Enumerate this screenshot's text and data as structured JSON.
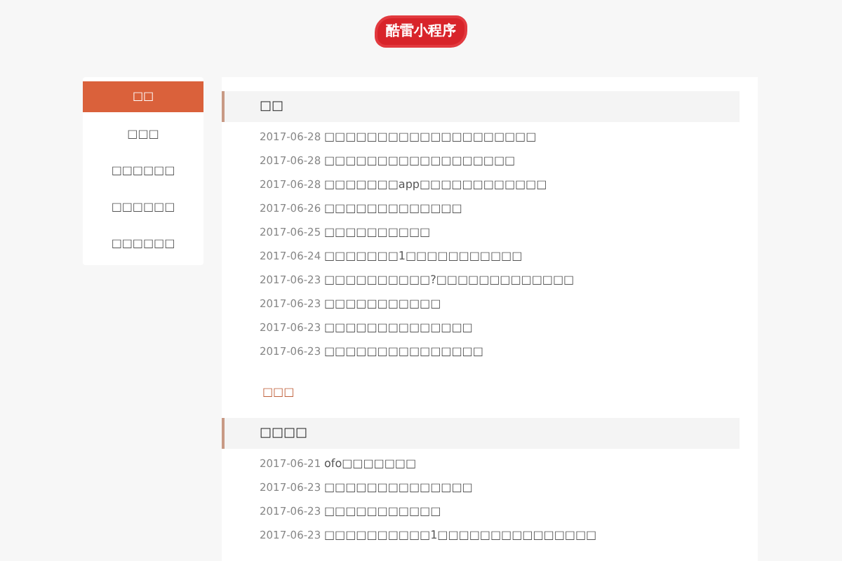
{
  "logo": {
    "text": "酷雷小程序"
  },
  "sidebar": {
    "items": [
      {
        "label": "□□",
        "selected": true
      },
      {
        "label": "□□□",
        "selected": false
      },
      {
        "label": "□□□□□□",
        "selected": false
      },
      {
        "label": "□□□□□□",
        "selected": false
      },
      {
        "label": "□□□□□□",
        "selected": false
      }
    ]
  },
  "sections": [
    {
      "title": "□□",
      "rows": [
        {
          "date": "2017-06-28",
          "title": "□□□□□□□□□□□□□□□□□□□□"
        },
        {
          "date": "2017-06-28",
          "title": "□□□□□□□□□□□□□□□□□□"
        },
        {
          "date": "2017-06-28",
          "title": "□□□□□□□app□□□□□□□□□□□□"
        },
        {
          "date": "2017-06-26",
          "title": "□□□□□□□□□□□□□"
        },
        {
          "date": "2017-06-25",
          "title": "□□□□□□□□□□"
        },
        {
          "date": "2017-06-24",
          "title": "□□□□□□□1□□□□□□□□□□□"
        },
        {
          "date": "2017-06-23",
          "title": "□□□□□□□□□□?□□□□□□□□□□□□□"
        },
        {
          "date": "2017-06-23",
          "title": "□□□□□□□□□□□"
        },
        {
          "date": "2017-06-23",
          "title": "□□□□□□□□□□□□□□"
        },
        {
          "date": "2017-06-23",
          "title": "□□□□□□□□□□□□□□□"
        }
      ],
      "more": "□□□"
    },
    {
      "title": "□□□□",
      "rows": [
        {
          "date": "2017-06-21",
          "title": "ofo□□□□□□□"
        },
        {
          "date": "2017-06-23",
          "title": "□□□□□□□□□□□□□□"
        },
        {
          "date": "2017-06-23",
          "title": "□□□□□□□□□□□"
        },
        {
          "date": "2017-06-23",
          "title": "□□□□□□□□□□1□□□□□□□□□□□□□□□"
        }
      ]
    }
  ]
}
